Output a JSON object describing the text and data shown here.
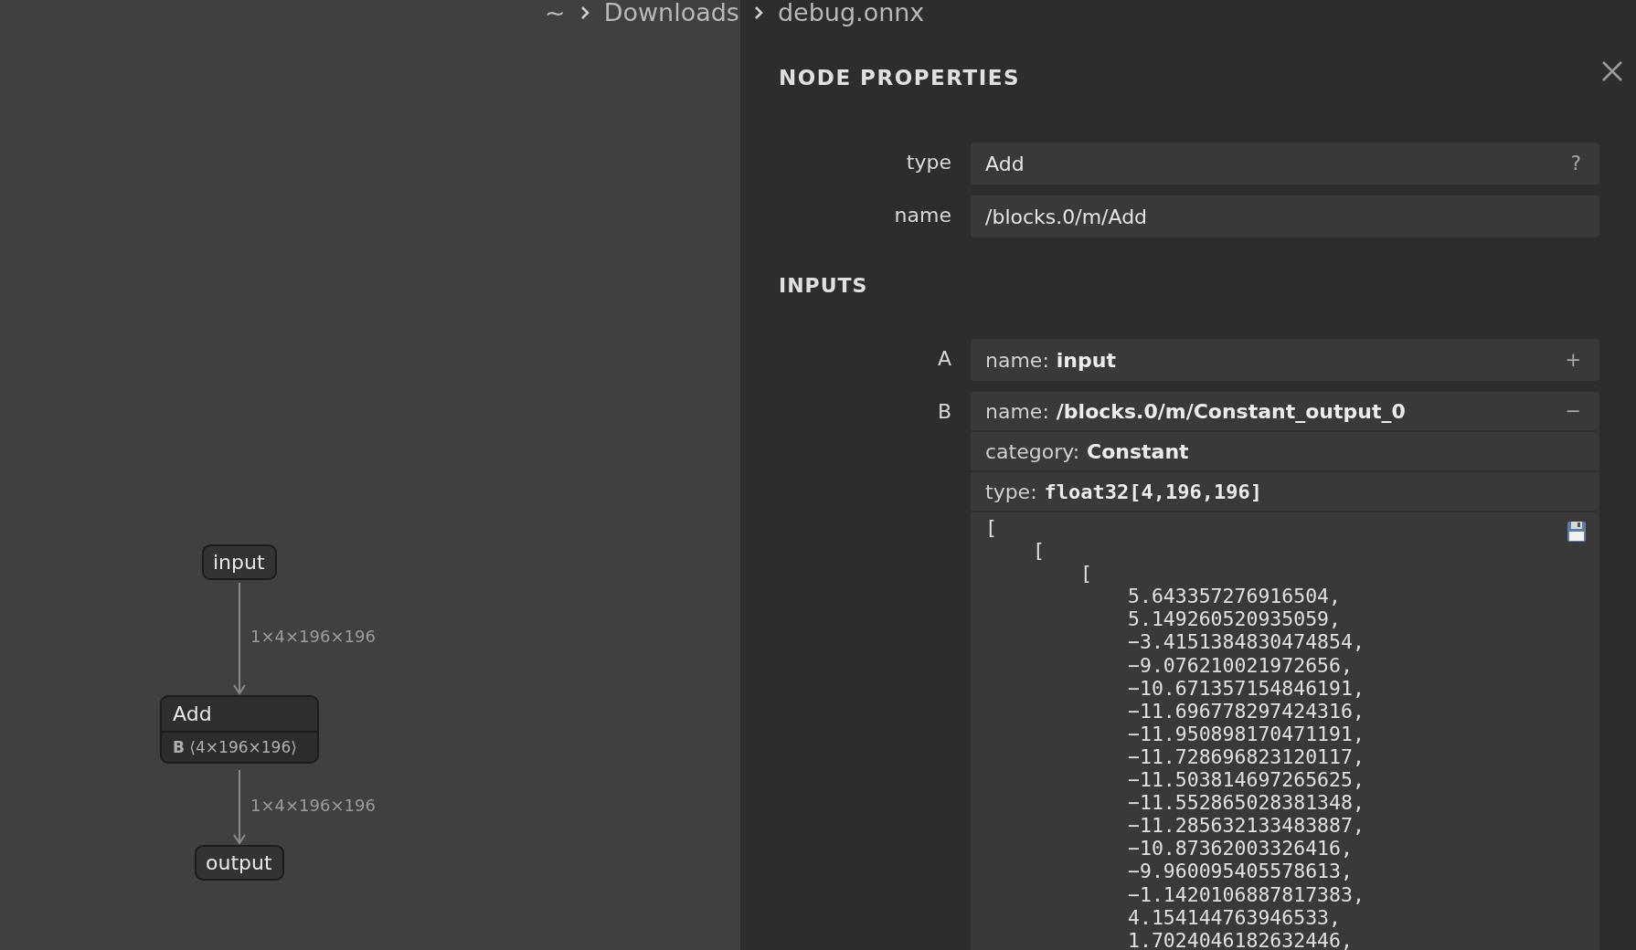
{
  "breadcrumb": [
    "~",
    "Downloads",
    "debug.onnx"
  ],
  "graph": {
    "nodes": [
      {
        "kind": "io",
        "label": "input"
      },
      {
        "kind": "op",
        "label": "Add",
        "attributes": [
          "**B** ⟨4×196×196⟩"
        ]
      },
      {
        "kind": "io",
        "label": "output"
      }
    ],
    "edges": [
      {
        "label": "1×4×196×196"
      },
      {
        "label": "1×4×196×196"
      }
    ]
  },
  "panel": {
    "title": "NODE PROPERTIES",
    "properties": [
      {
        "label": "type",
        "value": "Add",
        "action": "?"
      },
      {
        "label": "name",
        "value": "/blocks.0/m/Add"
      }
    ],
    "inputs_title": "INPUTS",
    "inputs": [
      {
        "label": "A",
        "name_label": "name:",
        "name": "input",
        "toggle": "+",
        "expanded": false
      },
      {
        "label": "B",
        "name_label": "name:",
        "name": "/blocks.0/m/Constant_output_0",
        "toggle": "−",
        "expanded": true,
        "details": [
          {
            "kind": "text",
            "label": "category:",
            "value": "Constant"
          },
          {
            "kind": "code",
            "label": "type:",
            "value": "float32[4,196,196]"
          }
        ],
        "tensor": {
          "text": "[",
          "children": [
            {
              "text": "[",
              "children": [
                {
                  "text": "[",
                  "children": [
                    {
                      "text": "5.643357276916504,"
                    },
                    {
                      "text": "5.149260520935059,"
                    },
                    {
                      "text": "−3.4151384830474854,"
                    },
                    {
                      "text": "−9.076210021972656,"
                    },
                    {
                      "text": "−10.671357154846191,"
                    },
                    {
                      "text": "−11.696778297424316,"
                    },
                    {
                      "text": "−11.950898170471191,"
                    },
                    {
                      "text": "−11.728696823120117,"
                    },
                    {
                      "text": "−11.503814697265625,"
                    },
                    {
                      "text": "−11.552865028381348,"
                    },
                    {
                      "text": "−11.285632133483887,"
                    },
                    {
                      "text": "−10.87362003326416,"
                    },
                    {
                      "text": "−9.960095405578613,"
                    },
                    {
                      "text": "−1.1420106887817383,"
                    },
                    {
                      "text": "4.154144763946533,"
                    },
                    {
                      "text": "1.7024046182632446,"
                    }
                  ]
                }
              ]
            }
          ]
        }
      }
    ]
  }
}
